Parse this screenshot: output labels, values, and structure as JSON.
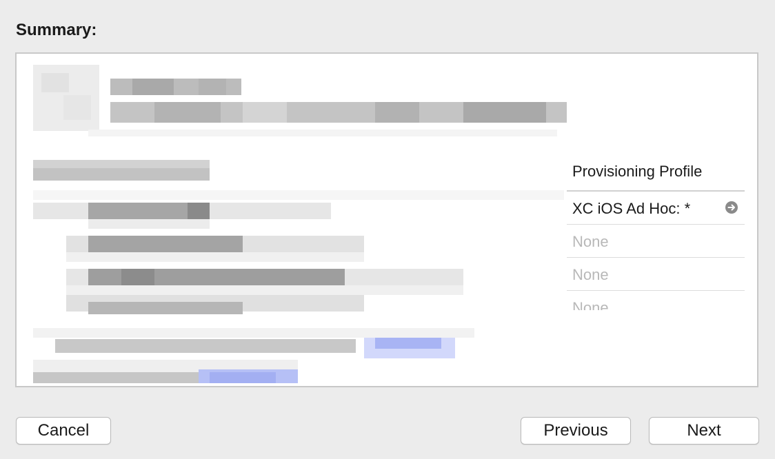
{
  "summary": {
    "title": "Summary:"
  },
  "profile_table": {
    "header": "Provisioning Profile",
    "rows": [
      {
        "value": "XC iOS Ad Hoc: *",
        "has_arrow": true
      },
      {
        "value": "None",
        "has_arrow": false
      },
      {
        "value": "None",
        "has_arrow": false
      },
      {
        "value": "None",
        "has_arrow": false
      }
    ]
  },
  "buttons": {
    "cancel": "Cancel",
    "previous": "Previous",
    "next": "Next"
  },
  "colors": {
    "background": "#ececec",
    "panel": "#ffffff",
    "muted_text": "#b8b8b8",
    "redacted_link": "#a8b4f4"
  },
  "icons": {
    "row_arrow": "circle-arrow-right-icon"
  }
}
